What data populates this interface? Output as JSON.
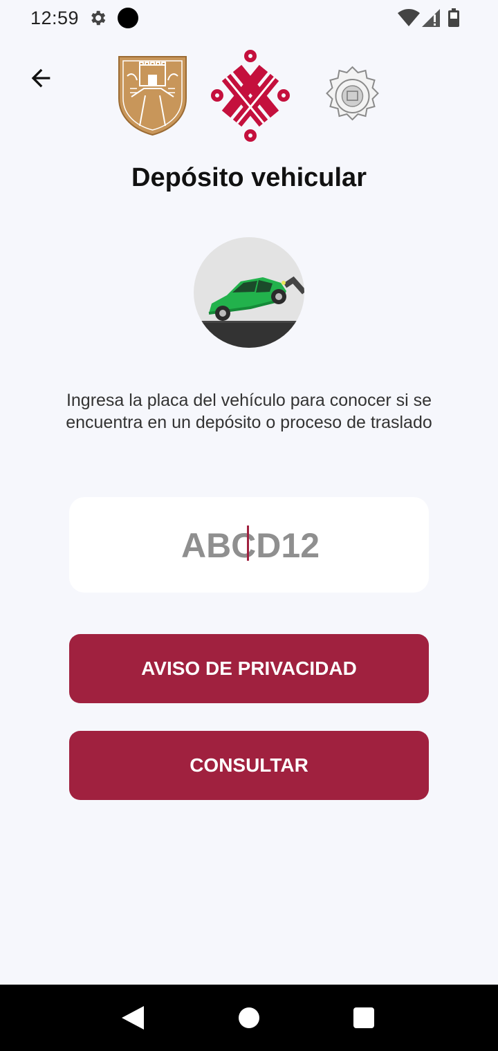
{
  "status_bar": {
    "time": "12:59",
    "icons": [
      "gear-icon",
      "notification-dot-icon",
      "wifi-icon",
      "signal-icon",
      "battery-icon"
    ]
  },
  "header": {
    "back_icon": "arrow-left-icon",
    "logos": [
      "cdmx-shield-logo",
      "cdmx-knot-logo",
      "police-badge-logo"
    ]
  },
  "page": {
    "title": "Depósito vehicular",
    "illustration": "tow-truck-car-icon",
    "description": "Ingresa la placa del vehículo para conocer si se encuentra en un depósito o proceso de traslado"
  },
  "plate_input": {
    "value": "",
    "placeholder": "ABCD12"
  },
  "buttons": {
    "privacy_label": "AVISO DE PRIVACIDAD",
    "consult_label": "CONSULTAR"
  },
  "colors": {
    "accent": "#a0213f",
    "background": "#f6f7fc",
    "shield_gold": "#c8965a",
    "car_green": "#22b24c"
  }
}
